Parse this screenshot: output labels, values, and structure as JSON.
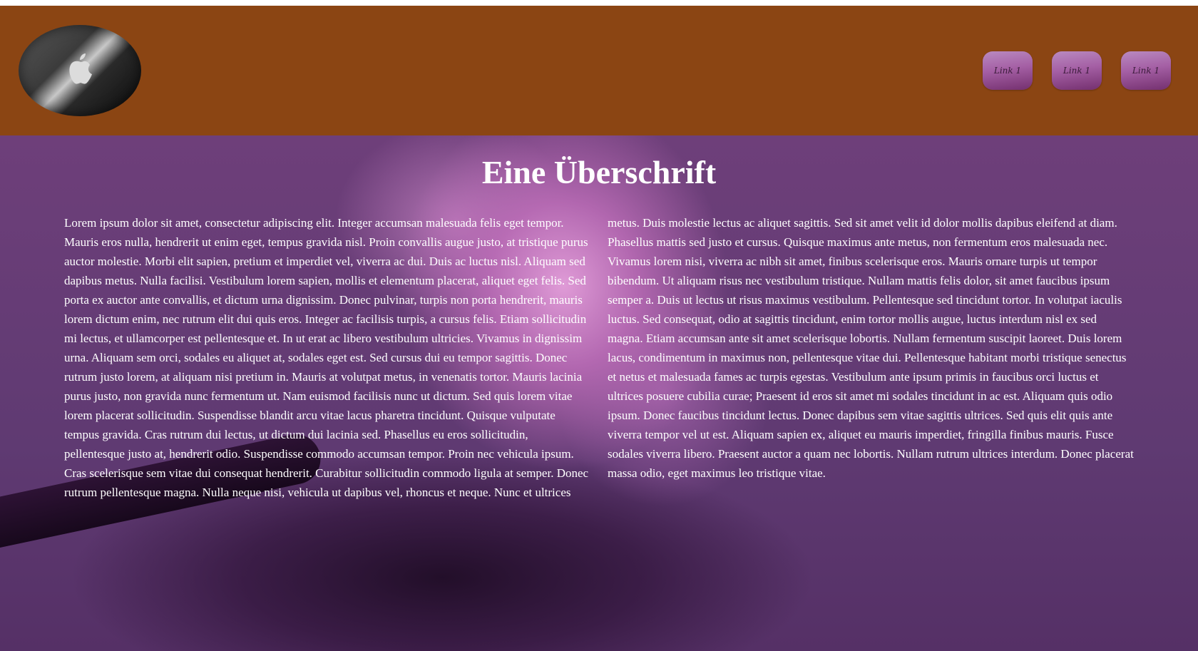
{
  "header": {
    "background_color": "#8b4513",
    "logo": {
      "icon": "apple-logo-icon"
    },
    "nav": [
      {
        "label": "Link 1"
      },
      {
        "label": "Link 1"
      },
      {
        "label": "Link 1"
      }
    ]
  },
  "hero": {
    "title": "Eine Überschrift",
    "body": "Lorem ipsum dolor sit amet, consectetur adipiscing elit. Integer accumsan malesuada felis eget tempor. Mauris eros nulla, hendrerit ut enim eget, tempus gravida nisl. Proin convallis augue justo, at tristique purus auctor molestie. Morbi elit sapien, pretium et imperdiet vel, viverra ac dui. Duis ac luctus nisl. Aliquam sed dapibus metus. Nulla facilisi. Vestibulum lorem sapien, mollis et elementum placerat, aliquet eget felis. Sed porta ex auctor ante convallis, et dictum urna dignissim. Donec pulvinar, turpis non porta hendrerit, mauris lorem dictum enim, nec rutrum elit dui quis eros. Integer ac facilisis turpis, a cursus felis. Etiam sollicitudin mi lectus, et ullamcorper est pellentesque et. In ut erat ac libero vestibulum ultricies. Vivamus in dignissim urna. Aliquam sem orci, sodales eu aliquet at, sodales eget est. Sed cursus dui eu tempor sagittis. Donec rutrum justo lorem, at aliquam nisi pretium in. Mauris at volutpat metus, in venenatis tortor. Mauris lacinia purus justo, non gravida nunc fermentum ut. Nam euismod facilisis nunc ut dictum. Sed quis lorem vitae lorem placerat sollicitudin. Suspendisse blandit arcu vitae lacus pharetra tincidunt. Quisque vulputate tempus gravida. Cras rutrum dui lectus, ut dictum dui lacinia sed. Phasellus eu eros sollicitudin, pellentesque justo at, hendrerit odio. Suspendisse commodo accumsan tempor. Proin nec vehicula ipsum. Cras scelerisque sem vitae dui consequat hendrerit. Curabitur sollicitudin commodo ligula at semper. Donec rutrum pellentesque magna. Nulla neque nisi, vehicula ut dapibus vel, rhoncus et neque. Nunc et ultrices metus. Duis molestie lectus ac aliquet sagittis. Sed sit amet velit id dolor mollis dapibus eleifend at diam. Phasellus mattis sed justo et cursus. Quisque maximus ante metus, non fermentum eros malesuada nec. Vivamus lorem nisi, viverra ac nibh sit amet, finibus scelerisque eros. Mauris ornare turpis ut tempor bibendum. Ut aliquam risus nec vestibulum tristique. Nullam mattis felis dolor, sit amet faucibus ipsum semper a. Duis ut lectus ut risus maximus vestibulum. Pellentesque sed tincidunt tortor. In volutpat iaculis luctus. Sed consequat, odio at sagittis tincidunt, enim tortor mollis augue, luctus interdum nisl ex sed magna. Etiam accumsan ante sit amet scelerisque lobortis. Nullam fermentum suscipit laoreet. Duis lorem lacus, condimentum in maximus non, pellentesque vitae dui. Pellentesque habitant morbi tristique senectus et netus et malesuada fames ac turpis egestas. Vestibulum ante ipsum primis in faucibus orci luctus et ultrices posuere cubilia curae; Praesent id eros sit amet mi sodales tincidunt in ac est. Aliquam quis odio ipsum. Donec faucibus tincidunt lectus. Donec dapibus sem vitae sagittis ultrices. Sed quis elit quis ante viverra tempor vel ut est. Aliquam sapien ex, aliquet eu mauris imperdiet, fringilla finibus mauris. Fusce sodales viverra libero. Praesent auctor a quam nec lobortis. Nullam rutrum ultrices interdum. Donec placerat massa odio, eget maximus leo tristique vitae."
  }
}
